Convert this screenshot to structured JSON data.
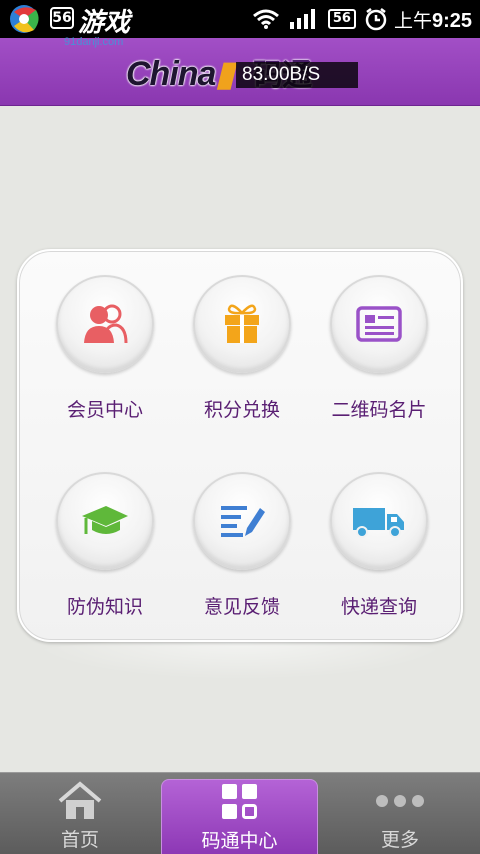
{
  "statusbar": {
    "badge": "56",
    "watermark_title": "游戏",
    "watermark_url": "91danji.com",
    "signal_box": "56",
    "time_prefix": "上午",
    "time": "9:25"
  },
  "header": {
    "brand": "China",
    "brand_overlay": "码通",
    "speed": "83.00B/S"
  },
  "menu": [
    {
      "label": "会员中心",
      "icon": "members-icon",
      "color": "#e85f63"
    },
    {
      "label": "积分兑换",
      "icon": "gift-icon",
      "color": "#f3a51a"
    },
    {
      "label": "二维码名片",
      "icon": "card-icon",
      "color": "#9a52c8"
    },
    {
      "label": "防伪知识",
      "icon": "graduation-cap-icon",
      "color": "#5fb83a"
    },
    {
      "label": "意见反馈",
      "icon": "feedback-edit-icon",
      "color": "#3f7fd3"
    },
    {
      "label": "快递查询",
      "icon": "delivery-truck-icon",
      "color": "#3ea3d8"
    }
  ],
  "tabbar": [
    {
      "label": "首页",
      "icon": "home-icon"
    },
    {
      "label": "码通中心",
      "icon": "grid-icon",
      "active": true
    },
    {
      "label": "更多",
      "icon": "more-dots-icon"
    }
  ]
}
